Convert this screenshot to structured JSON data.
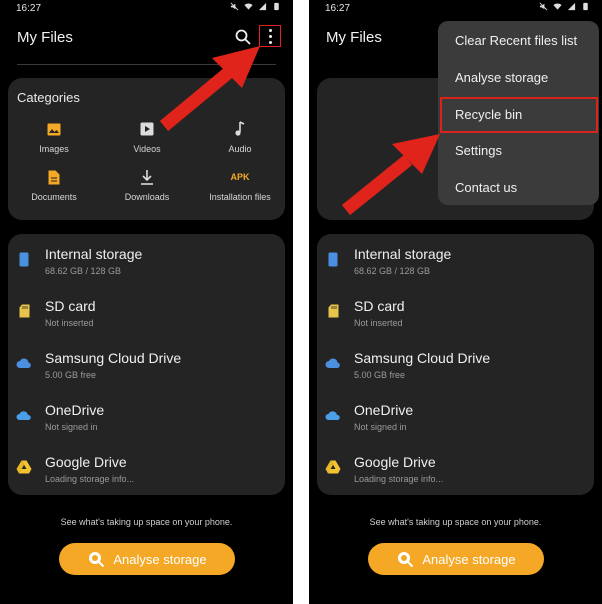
{
  "status": {
    "time": "16:27"
  },
  "app": {
    "title": "My Files"
  },
  "categories": {
    "title": "Categories",
    "items": [
      {
        "label": "Images",
        "icon": "image-icon"
      },
      {
        "label": "Videos",
        "icon": "video-icon"
      },
      {
        "label": "Audio",
        "icon": "music-note-icon"
      },
      {
        "label": "Documents",
        "icon": "document-icon"
      },
      {
        "label": "Downloads",
        "icon": "download-icon"
      },
      {
        "label": "Installation files",
        "icon": "apk-icon",
        "icon_text": "APK"
      }
    ]
  },
  "storage": [
    {
      "name": "Internal storage",
      "sub": "68.62 GB / 128 GB",
      "icon": "phone-icon"
    },
    {
      "name": "SD card",
      "sub": "Not inserted",
      "icon": "sd-card-icon"
    },
    {
      "name": "Samsung Cloud Drive",
      "sub": "5.00 GB free",
      "icon": "cloud-icon"
    },
    {
      "name": "OneDrive",
      "sub": "Not signed in",
      "icon": "onedrive-icon"
    },
    {
      "name": "Google Drive",
      "sub": "Loading storage info...",
      "icon": "google-drive-icon"
    }
  ],
  "hint": "See what's taking up space on your phone.",
  "analyse_button": "Analyse storage",
  "menu": {
    "items": [
      "Clear Recent files list",
      "Analyse storage",
      "Recycle bin",
      "Settings",
      "Contact us"
    ],
    "highlighted": "Recycle bin"
  },
  "colors": {
    "accent": "#f4a825",
    "annotation": "#e0241b",
    "card": "#242424",
    "menu": "#3b3b3b"
  }
}
